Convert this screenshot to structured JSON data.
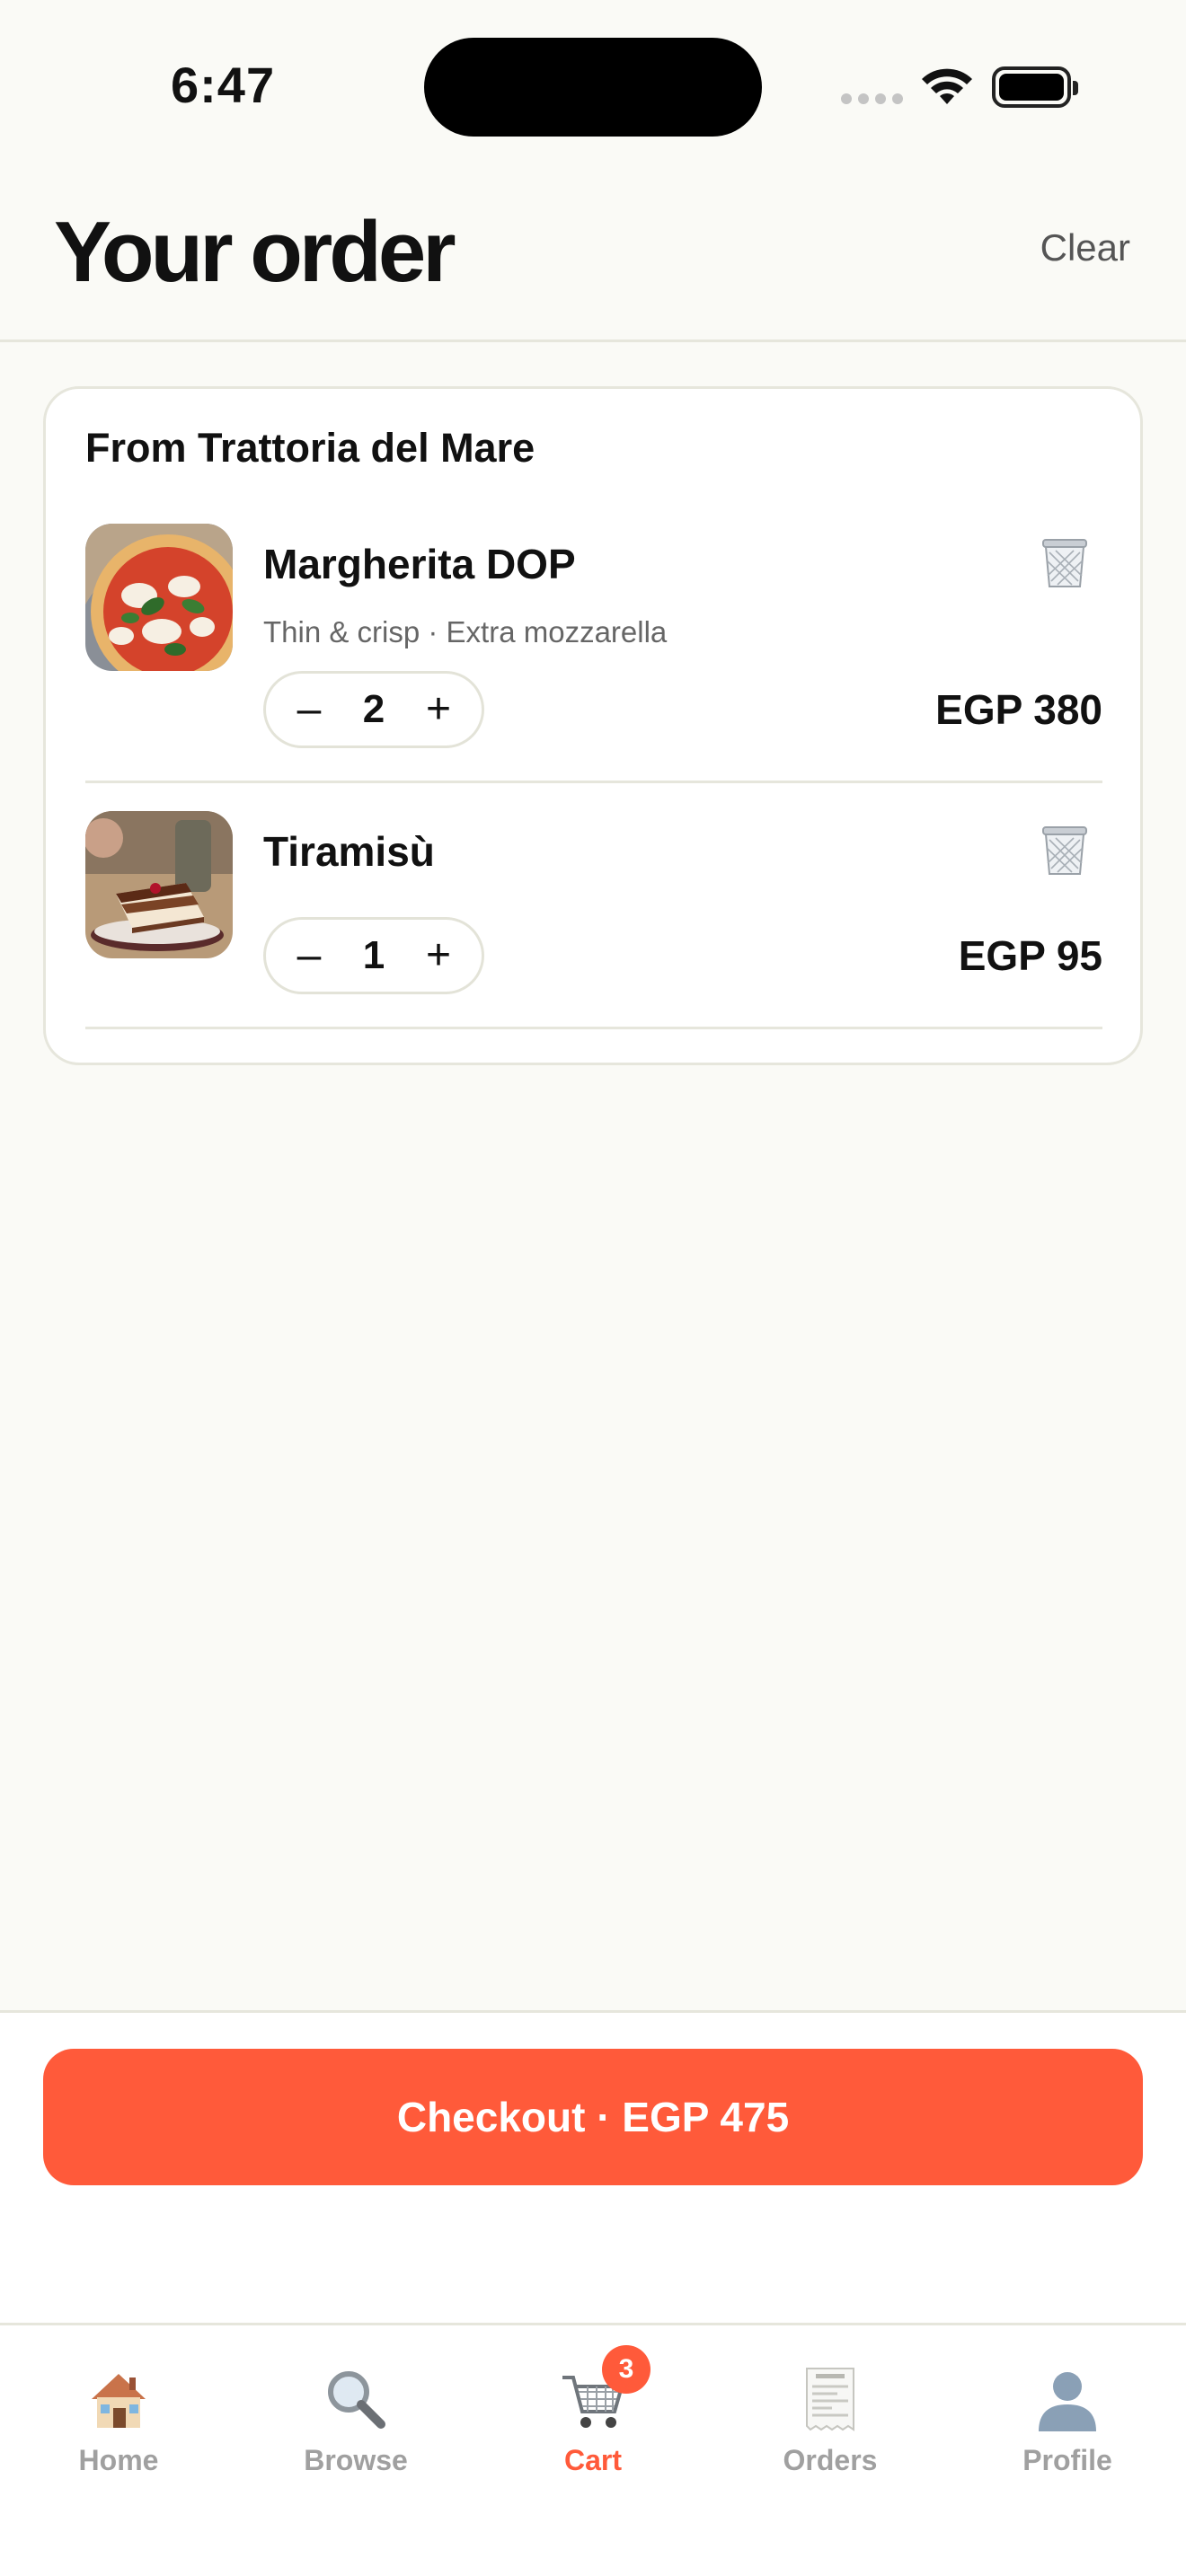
{
  "status_bar": {
    "time": "6:47"
  },
  "header": {
    "title": "Your order",
    "clear_label": "Clear"
  },
  "cart": {
    "restaurant": "From Trattoria del Mare",
    "items": [
      {
        "name": "Margherita DOP",
        "options": "Thin & crisp · Extra mozzarella",
        "quantity": "2",
        "price": "EGP 380",
        "image": "pizza-photo"
      },
      {
        "name": "Tiramisù",
        "options": "",
        "quantity": "1",
        "price": "EGP 95",
        "image": "tiramisu-photo"
      }
    ],
    "decrement_label": "–",
    "increment_label": "+"
  },
  "checkout": {
    "label": "Checkout · EGP 475"
  },
  "tabbar": {
    "tabs": [
      {
        "label": "Home",
        "icon": "house-icon"
      },
      {
        "label": "Browse",
        "icon": "magnifier-icon"
      },
      {
        "label": "Cart",
        "icon": "cart-icon",
        "badge": "3",
        "active": true
      },
      {
        "label": "Orders",
        "icon": "receipt-icon"
      },
      {
        "label": "Profile",
        "icon": "person-icon"
      }
    ]
  },
  "colors": {
    "accent": "#ff5a3a",
    "background": "#fafaf6",
    "border": "#e6e6dc"
  }
}
